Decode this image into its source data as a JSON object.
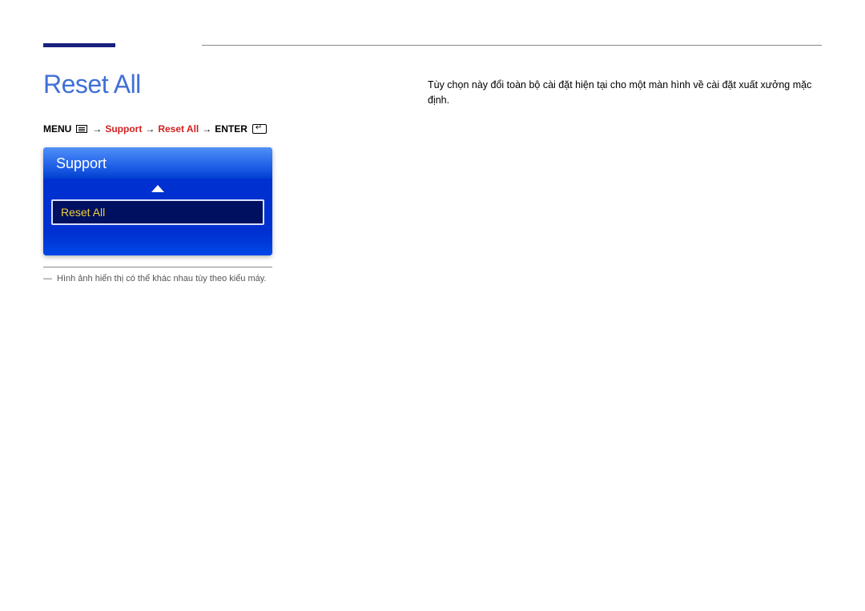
{
  "pageTitle": "Reset All",
  "breadcrumb": {
    "menu": "MENU",
    "support": "Support",
    "resetAll": "Reset All",
    "enter": "ENTER",
    "arrow": "→"
  },
  "osd": {
    "header": "Support",
    "item": "Reset All"
  },
  "footnote": {
    "dash": "―",
    "text": "Hình ảnh hiển thị có thể khác nhau tùy theo kiểu máy."
  },
  "description": "Tùy chọn này đổi toàn bộ cài đặt hiện tại cho một màn hình về cài đặt xuất xưởng mặc định."
}
